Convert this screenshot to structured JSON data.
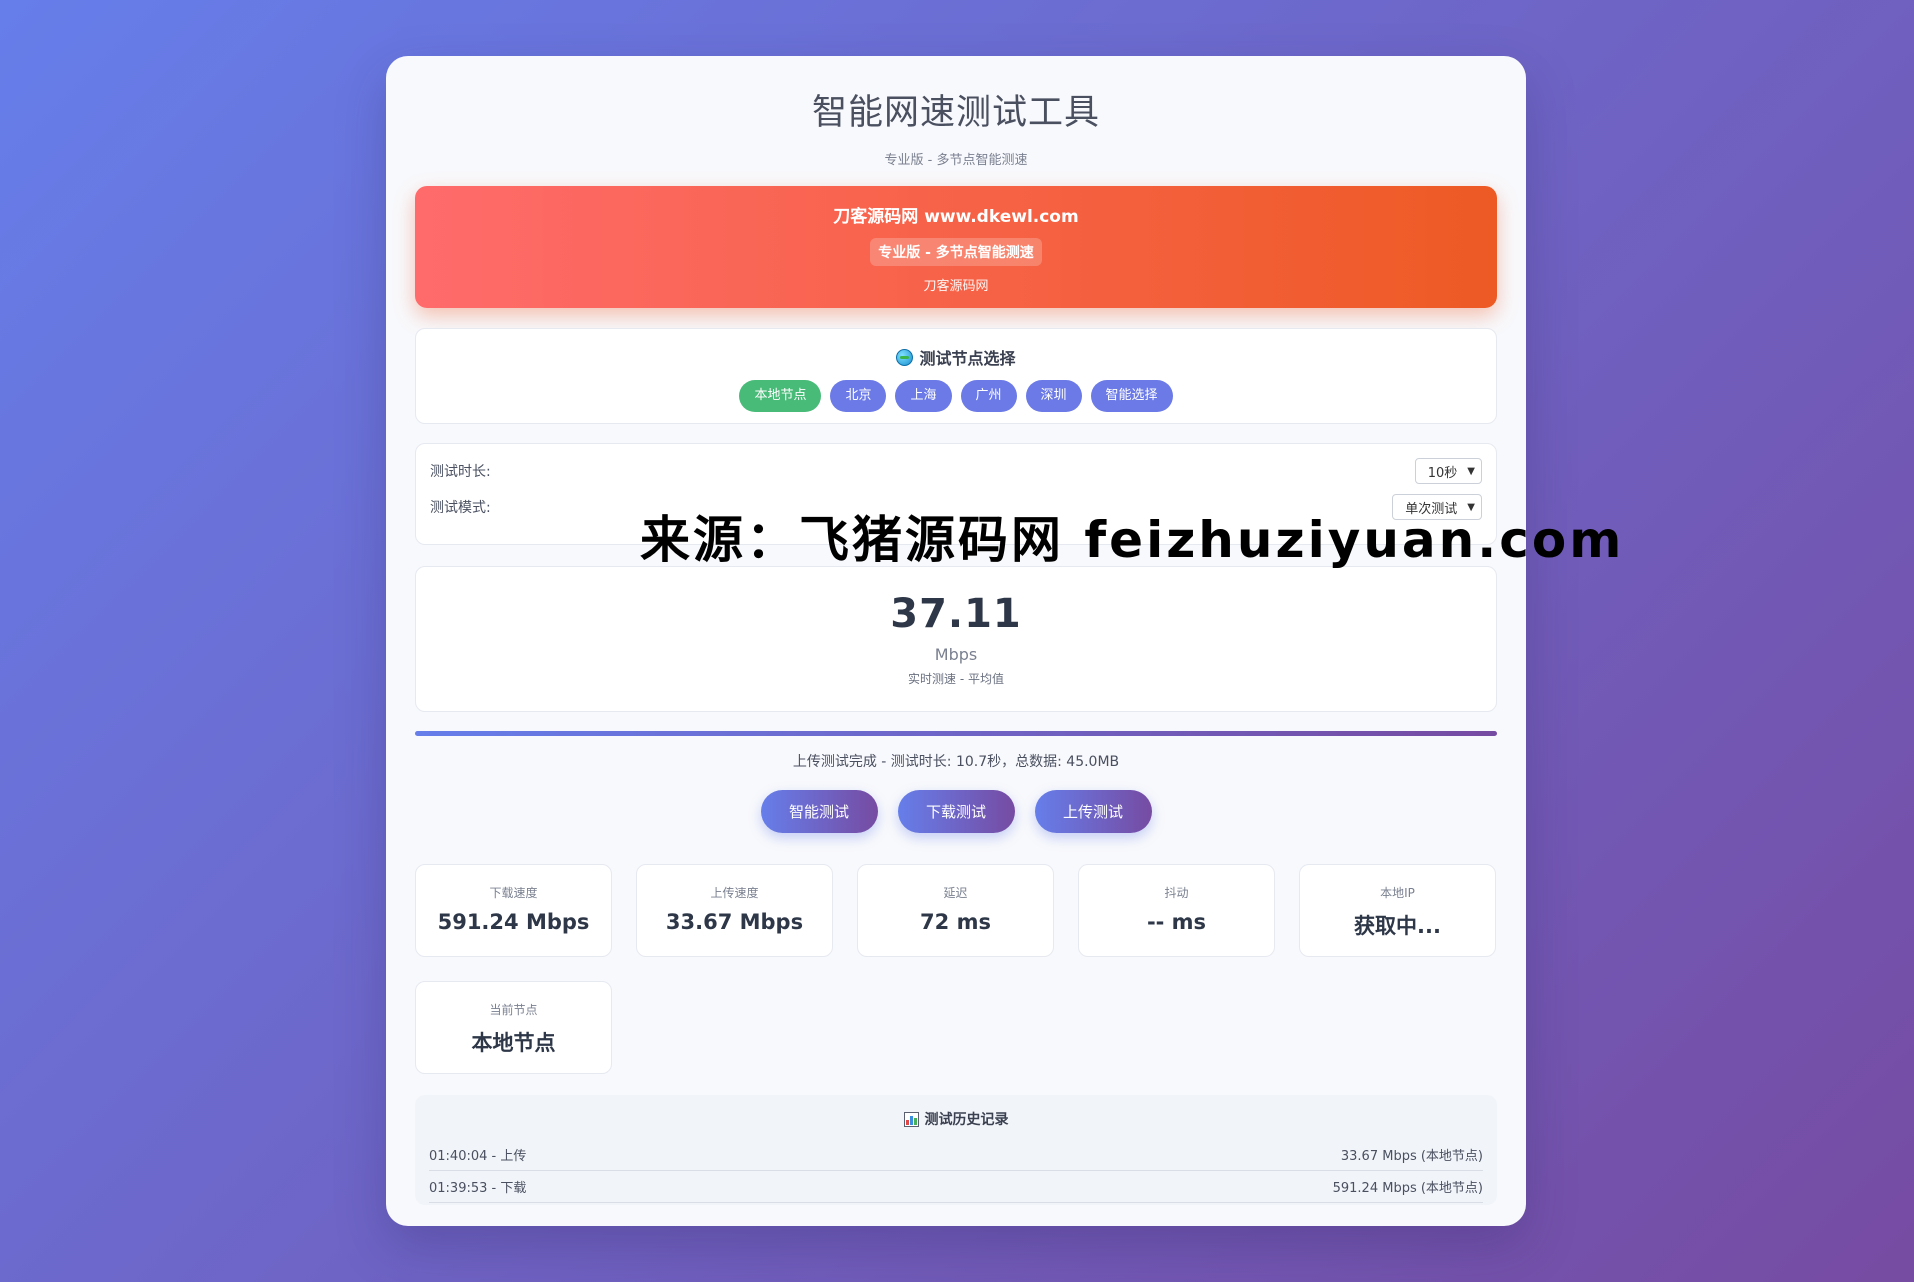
{
  "app": {
    "title": "智能网速测试工具",
    "subtitle": "专业版 - 多节点智能测速"
  },
  "banner": {
    "site": "刀客源码网 www.dkewl.com",
    "badge": "专业版 - 多节点智能测速",
    "sub": "刀客源码网"
  },
  "nodes": {
    "title": "测试节点选择",
    "icon": "globe-icon",
    "items": [
      "本地节点",
      "北京",
      "上海",
      "广州",
      "深圳",
      "智能选择"
    ],
    "active_color": "#48bb78",
    "color": "#6b7ae6"
  },
  "settings": {
    "duration_label": "测试时长:",
    "duration_value": "10秒",
    "mode_label": "测试模式:",
    "mode_value": "单次测试"
  },
  "speed": {
    "value": "37.11",
    "unit": "Mbps",
    "note": "实时测速 - 平均值"
  },
  "progress": {
    "percent": 100
  },
  "status": "上传测试完成 - 测试时长: 10.7秒，总数据: 45.0MB",
  "actions": {
    "smart": "智能测试",
    "download": "下载测试",
    "upload": "上传测试"
  },
  "stats": {
    "download_label": "下载速度",
    "download_value": "591.24 Mbps",
    "upload_label": "上传速度",
    "upload_value": "33.67 Mbps",
    "latency_label": "延迟",
    "latency_value": "72 ms",
    "jitter_label": "抖动",
    "jitter_value": "-- ms",
    "ip_label": "本地IP",
    "ip_value": "获取中...",
    "node_label": "当前节点",
    "node_value": "本地节点"
  },
  "history": {
    "title": "测试历史记录",
    "icon": "bar-chart-icon",
    "rows": [
      {
        "left": "01:40:04 - 上传",
        "right": "33.67 Mbps (本地节点)"
      },
      {
        "left": "01:39:53 - 下载",
        "right": "591.24 Mbps (本地节点)"
      }
    ]
  },
  "watermark": "来源：飞猪源码网 feizhuziyuan.com",
  "colors": {
    "accent_start": "#667eea",
    "accent_end": "#764ba2",
    "banner_start": "#ff6b6b",
    "banner_end": "#ee5a24"
  }
}
